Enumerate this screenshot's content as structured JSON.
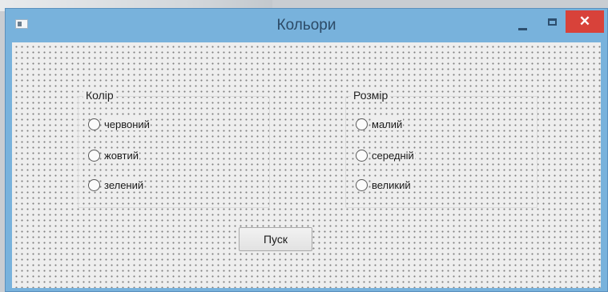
{
  "window": {
    "title": "Кольори",
    "close_glyph": "✕"
  },
  "groups": [
    {
      "title": "Колір",
      "options": [
        "червоний",
        "жовтий",
        "зелений"
      ]
    },
    {
      "title": "Розмір",
      "options": [
        "малий",
        "середній",
        "великий"
      ]
    }
  ],
  "start_button": {
    "label": "Пуск"
  },
  "icons": {
    "app": "app-icon",
    "minimize": "minimize-icon",
    "maximize": "maximize-icon",
    "close": "close-icon"
  }
}
